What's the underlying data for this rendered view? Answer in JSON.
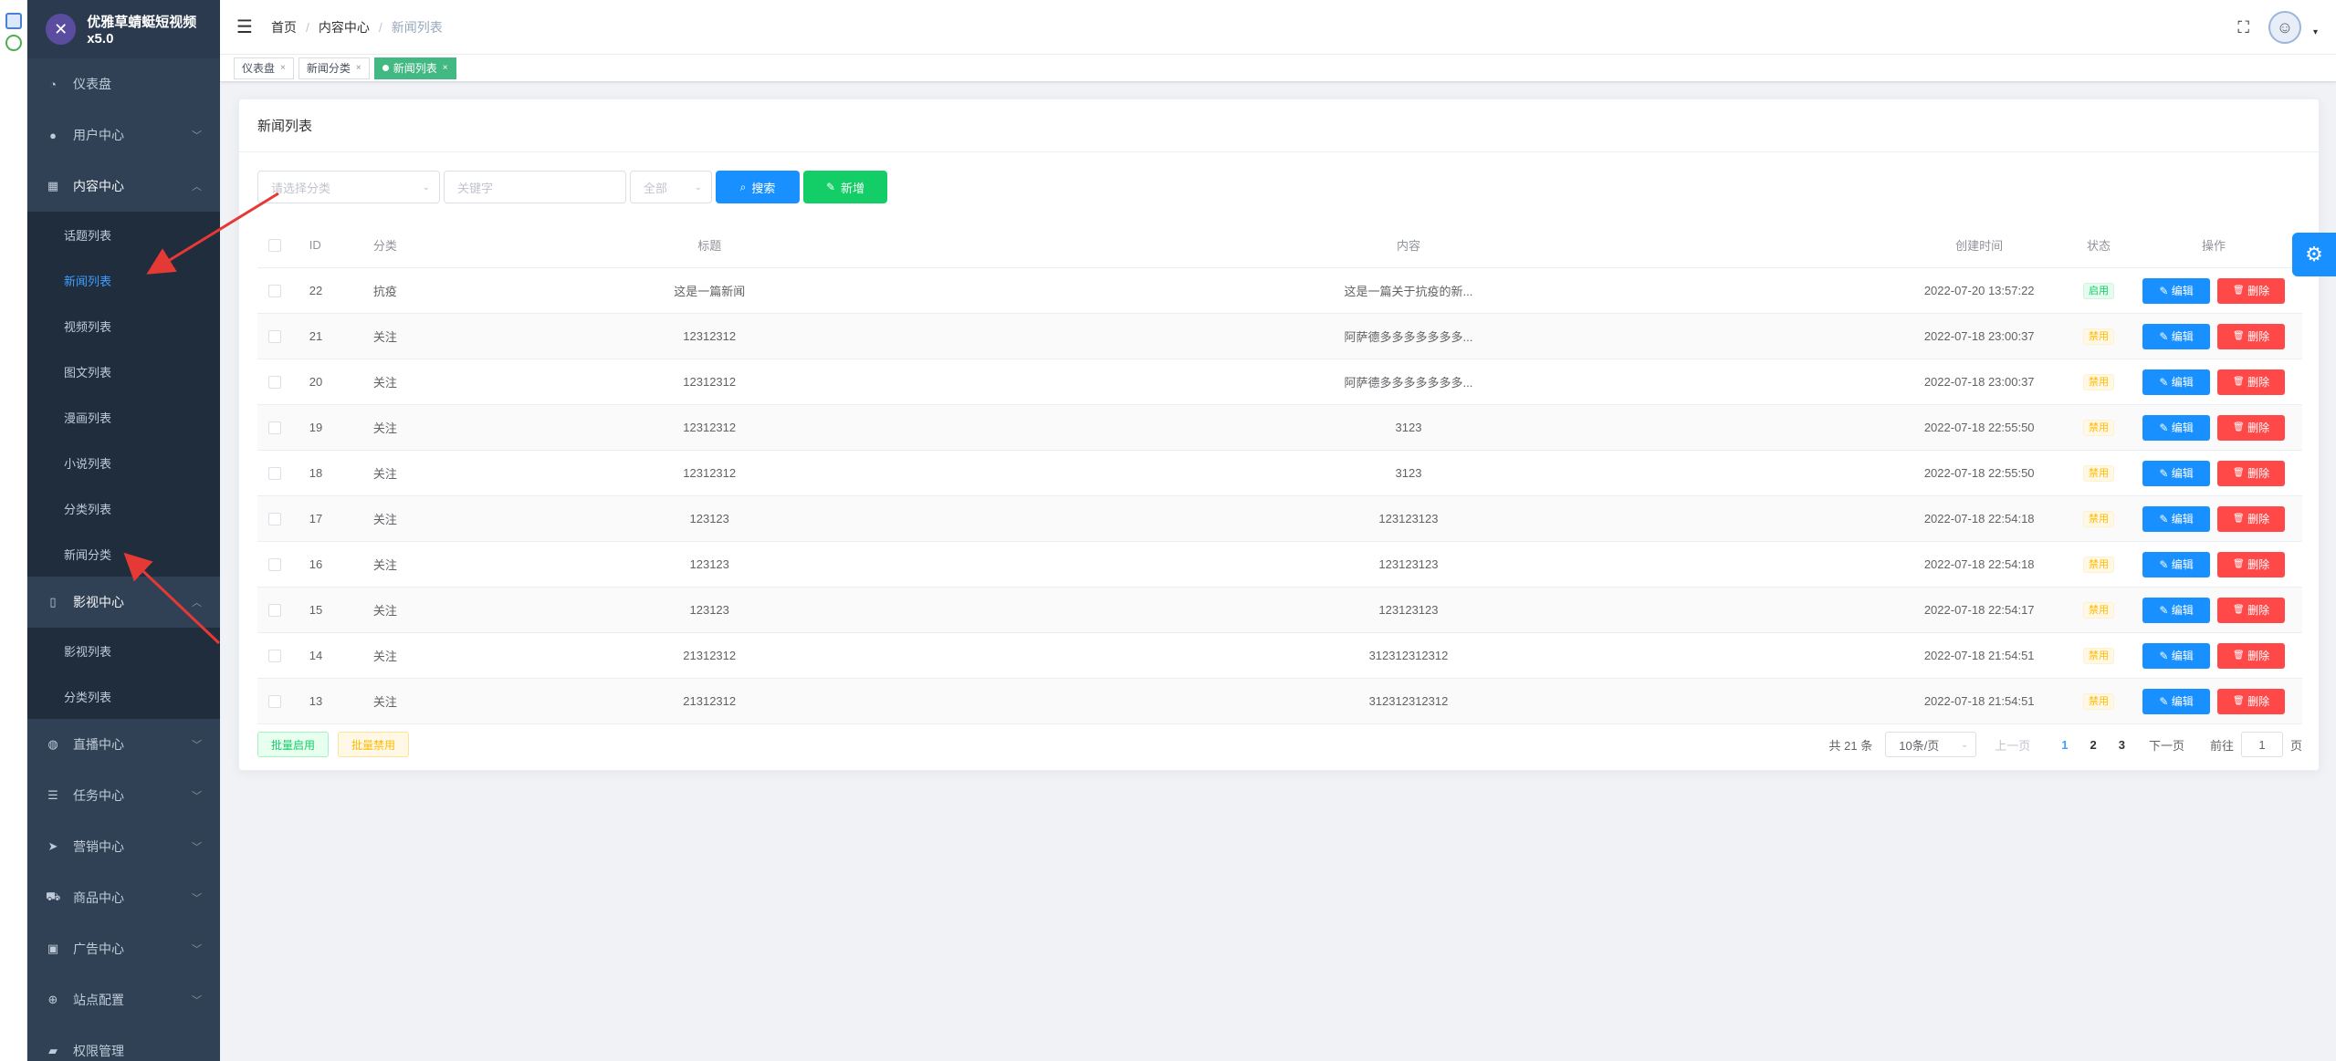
{
  "app": {
    "title": "优雅草蜻蜓短视频x5.0",
    "logo_glyph": "✕"
  },
  "sidebar": {
    "items": [
      {
        "label": "仪表盘",
        "icon": "dashboard-icon",
        "glyph": "◔",
        "expandable": false
      },
      {
        "label": "用户中心",
        "icon": "user-icon",
        "glyph": "●",
        "expandable": true,
        "chevron": "﹀"
      },
      {
        "label": "内容中心",
        "icon": "grid-icon",
        "glyph": "▦",
        "expandable": true,
        "chevron": "︿",
        "children": [
          {
            "label": "话题列表"
          },
          {
            "label": "新闻列表"
          },
          {
            "label": "视频列表"
          },
          {
            "label": "图文列表"
          },
          {
            "label": "漫画列表"
          },
          {
            "label": "小说列表"
          },
          {
            "label": "分类列表"
          },
          {
            "label": "新闻分类"
          }
        ]
      },
      {
        "label": "影视中心",
        "icon": "book-icon",
        "glyph": "▯",
        "expandable": true,
        "chevron": "︿",
        "children": [
          {
            "label": "影视列表"
          },
          {
            "label": "分类列表"
          }
        ]
      },
      {
        "label": "直播中心",
        "icon": "globe-icon",
        "glyph": "◍",
        "chevron": "﹀"
      },
      {
        "label": "任务中心",
        "icon": "list-icon",
        "glyph": "☰",
        "chevron": "﹀"
      },
      {
        "label": "营销中心",
        "icon": "send-icon",
        "glyph": "➤",
        "chevron": "﹀"
      },
      {
        "label": "商品中心",
        "icon": "cart-icon",
        "glyph": "⛟",
        "chevron": "﹀"
      },
      {
        "label": "广告中心",
        "icon": "ad-icon",
        "glyph": "▣",
        "chevron": "﹀"
      },
      {
        "label": "站点配置",
        "icon": "target-icon",
        "glyph": "⊕",
        "chevron": "﹀"
      },
      {
        "label": "权限管理",
        "icon": "lock-icon",
        "glyph": "▰",
        "chevron": ""
      }
    ]
  },
  "header": {
    "hamburger_glyph": "☰",
    "breadcrumb": [
      "首页",
      "内容中心",
      "新闻列表"
    ],
    "breadcrumb_sep": "/",
    "fullscreen_glyph": "⛶",
    "avatar_glyph": "☺",
    "caret_glyph": "▾"
  },
  "tags": [
    {
      "label": "仪表盘",
      "close": "×"
    },
    {
      "label": "新闻分类",
      "close": "×"
    },
    {
      "label": "新闻列表",
      "close": "×"
    }
  ],
  "card": {
    "title": "新闻列表"
  },
  "filters": {
    "category_placeholder": "请选择分类",
    "keyword_placeholder": "关键字",
    "status_value": "全部",
    "arrow_glyph": "⌄",
    "search_label": "搜索",
    "search_glyph": "⌕",
    "add_label": "新增",
    "add_glyph": "✎"
  },
  "table": {
    "headers": {
      "id": "ID",
      "category": "分类",
      "title": "标题",
      "content": "内容",
      "created": "创建时间",
      "status": "状态",
      "ops": "操作"
    },
    "edit_label": "编辑",
    "edit_glyph": "✎",
    "delete_label": "删除",
    "delete_glyph": "🗑",
    "rows": [
      {
        "id": "22",
        "category": "抗疫",
        "title": "这是一篇新闻",
        "content": "这是一篇关于抗疫的新...",
        "created": "2022-07-20 13:57:22",
        "status": "启用",
        "status_type": "on"
      },
      {
        "id": "21",
        "category": "关注",
        "title": "12312312",
        "content": "阿萨德多多多多多多多...",
        "created": "2022-07-18 23:00:37",
        "status": "禁用",
        "status_type": "off"
      },
      {
        "id": "20",
        "category": "关注",
        "title": "12312312",
        "content": "阿萨德多多多多多多多...",
        "created": "2022-07-18 23:00:37",
        "status": "禁用",
        "status_type": "off"
      },
      {
        "id": "19",
        "category": "关注",
        "title": "12312312",
        "content": "3123",
        "created": "2022-07-18 22:55:50",
        "status": "禁用",
        "status_type": "off"
      },
      {
        "id": "18",
        "category": "关注",
        "title": "12312312",
        "content": "3123",
        "created": "2022-07-18 22:55:50",
        "status": "禁用",
        "status_type": "off"
      },
      {
        "id": "17",
        "category": "关注",
        "title": "123123",
        "content": "123123123",
        "created": "2022-07-18 22:54:18",
        "status": "禁用",
        "status_type": "off"
      },
      {
        "id": "16",
        "category": "关注",
        "title": "123123",
        "content": "123123123",
        "created": "2022-07-18 22:54:18",
        "status": "禁用",
        "status_type": "off"
      },
      {
        "id": "15",
        "category": "关注",
        "title": "123123",
        "content": "123123123",
        "created": "2022-07-18 22:54:17",
        "status": "禁用",
        "status_type": "off"
      },
      {
        "id": "14",
        "category": "关注",
        "title": "21312312",
        "content": "312312312312",
        "created": "2022-07-18 21:54:51",
        "status": "禁用",
        "status_type": "off"
      },
      {
        "id": "13",
        "category": "关注",
        "title": "21312312",
        "content": "312312312312",
        "created": "2022-07-18 21:54:51",
        "status": "禁用",
        "status_type": "off"
      }
    ]
  },
  "bulk": {
    "enable_label": "批量启用",
    "disable_label": "批量禁用"
  },
  "pagination": {
    "total_text": "共 21 条",
    "page_size": "10条/页",
    "prev_label": "上一页",
    "pages": [
      "1",
      "2",
      "3"
    ],
    "current_page": "1",
    "next_label": "下一页",
    "goto_label": "前往",
    "goto_value": "1",
    "page_suffix": "页"
  },
  "settings_fab_glyph": "⚙",
  "colors": {
    "sidebar_bg": "#304156",
    "primary": "#1890ff",
    "success": "#13ce66",
    "danger": "#ff4949",
    "tag_active": "#42b983",
    "annotation_arrow": "#e53935"
  }
}
